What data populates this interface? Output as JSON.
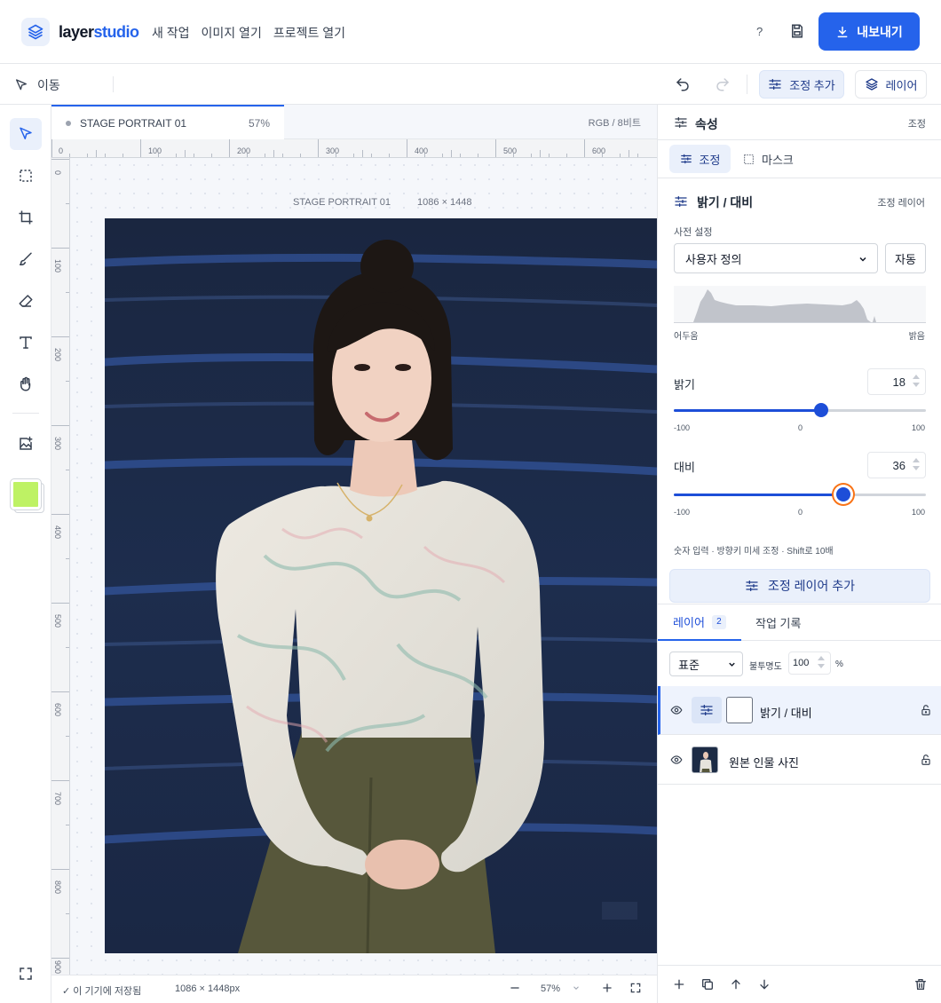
{
  "app": {
    "brand_part1": "layer",
    "brand_part2": "studio",
    "menu": [
      "새 작업",
      "이미지 열기",
      "프로젝트 열기"
    ],
    "help_label": "?",
    "export_label": "내보내기"
  },
  "toolbar": {
    "move_label": "이동",
    "add_adjustment_label": "조정 추가",
    "layers_label": "레이어"
  },
  "colors": {
    "accent": "#2563eb",
    "foreground_color": "#bef264"
  },
  "document": {
    "tab_title": "STAGE PORTRAIT 01",
    "tab_zoom": "57%",
    "color_mode": "RGB / 8비트",
    "canvas_caption_title": "STAGE PORTRAIT 01",
    "canvas_caption_size": "1086 × 1448",
    "ruler_h": [
      "0",
      "100",
      "200",
      "300",
      "400",
      "500",
      "600"
    ],
    "ruler_v": [
      "0",
      "100",
      "200",
      "300",
      "400",
      "500",
      "600",
      "700",
      "800",
      "900"
    ]
  },
  "status": {
    "saved": "✓ 이 기기에 저장됨",
    "dimensions": "1086 × 1448px",
    "zoom": "57%"
  },
  "properties": {
    "title": "속성",
    "context": "조정",
    "seg_adjust": "조정",
    "seg_mask": "마스크",
    "adj_title": "밝기 / 대비",
    "adj_kind": "조정 레이어",
    "preset_label": "사전 설정",
    "preset_value": "사용자 정의",
    "auto_button": "자동",
    "hist_dark": "어두움",
    "hist_light": "밝음",
    "brightness_label": "밝기",
    "brightness_value": "18",
    "contrast_label": "대비",
    "contrast_value": "36",
    "slider_min": "-100",
    "slider_mid": "0",
    "slider_max": "100",
    "hint": "숫자 입력 · 방향키 미세 조정 · Shift로 10배",
    "add_adjustment_layer": "조정 레이어 추가"
  },
  "layers_panel": {
    "tab_layers": "레이어",
    "layer_count": "2",
    "tab_history": "작업 기록",
    "blend_mode": "표준",
    "opacity_label": "불투명도",
    "opacity_value": "100",
    "opacity_unit": "%",
    "layers": [
      {
        "name": "밝기 / 대비",
        "selected": true
      },
      {
        "name": "원본 인물 사진",
        "selected": false
      }
    ]
  }
}
